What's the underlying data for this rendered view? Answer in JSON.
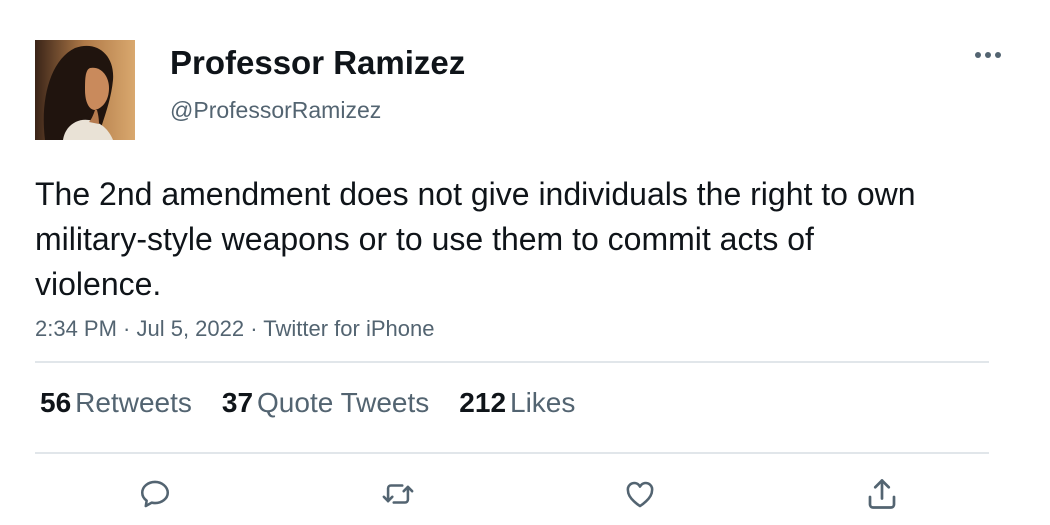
{
  "author": {
    "display_name": "Professor Ramizez",
    "handle": "@ProfessorRamizez"
  },
  "tweet": {
    "text": "The 2nd amendment does not give individuals the right to own military-style weapons or to use them to commit acts of violence.",
    "meta": "2:34 PM · Jul 5, 2022 · Twitter for iPhone"
  },
  "stats": {
    "retweets_count": "56",
    "retweets_label": "Retweets",
    "quotes_count": "37",
    "quotes_label": "Quote Tweets",
    "likes_count": "212",
    "likes_label": "Likes"
  },
  "icons": {
    "more": "more-icon",
    "reply": "reply-icon",
    "retweet": "retweet-icon",
    "like": "heart-icon",
    "share": "share-icon"
  },
  "colors": {
    "text_primary": "#0f1419",
    "text_secondary": "#536471",
    "divider": "#e1e6ea"
  }
}
